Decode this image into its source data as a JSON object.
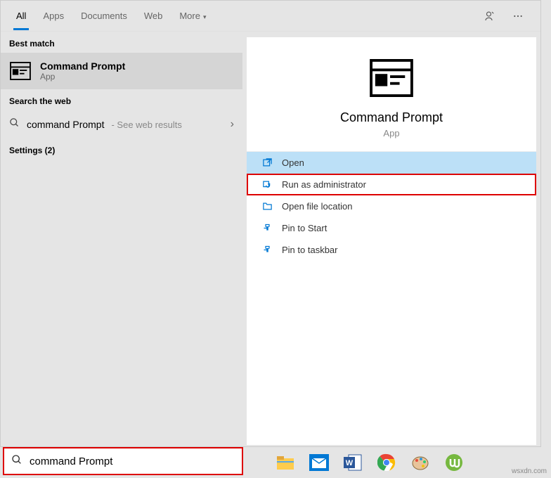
{
  "tabs": {
    "all": "All",
    "apps": "Apps",
    "documents": "Documents",
    "web": "Web",
    "more": "More"
  },
  "sections": {
    "bestMatch": "Best match",
    "searchWeb": "Search the web",
    "settings": "Settings (2)"
  },
  "bestMatch": {
    "title": "Command Prompt",
    "subtitle": "App"
  },
  "webResult": {
    "query": "command Prompt",
    "hint": " - See web results"
  },
  "preview": {
    "title": "Command Prompt",
    "subtitle": "App"
  },
  "actions": {
    "open": "Open",
    "runAdmin": "Run as administrator",
    "openLocation": "Open file location",
    "pinStart": "Pin to Start",
    "pinTaskbar": "Pin to taskbar"
  },
  "searchInput": {
    "value": "command Prompt"
  },
  "watermark": "wsxdn.com"
}
